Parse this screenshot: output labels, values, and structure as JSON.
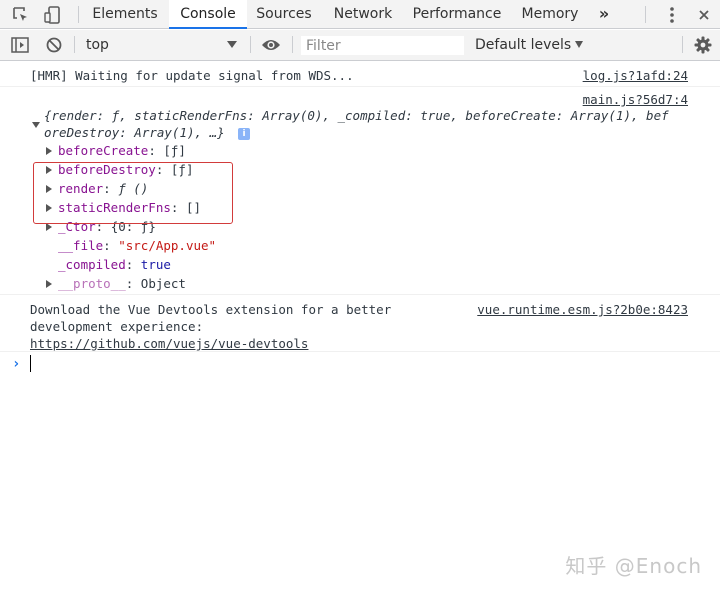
{
  "tabs": [
    {
      "label": "Elements"
    },
    {
      "label": "Console"
    },
    {
      "label": "Sources"
    },
    {
      "label": "Network"
    },
    {
      "label": "Performance"
    },
    {
      "label": "Memory"
    }
  ],
  "more_tabs": "»",
  "toolbar": {
    "context": "top",
    "filter_placeholder": "Filter",
    "levels": "Default levels"
  },
  "console": {
    "hmr": {
      "text": "[HMR] Waiting for update signal from WDS...",
      "source": "log.js?1afd:24"
    },
    "object": {
      "source": "main.js?56d7:4",
      "summary_line1": "{render: ƒ, staticRenderFns: Array(0), _compiled: true, beforeCreate: Array(1), bef",
      "summary_line2": "oreDestroy: Array(1), …}",
      "props": [
        {
          "name": "beforeCreate",
          "value": "[ƒ]"
        },
        {
          "name": "beforeDestroy",
          "value": "[ƒ]"
        },
        {
          "name": "render",
          "value": "ƒ ()"
        },
        {
          "name": "staticRenderFns",
          "value": "[]"
        },
        {
          "name": "_Ctor",
          "value": "{0: ƒ}"
        },
        {
          "name": "__file",
          "value": "\"src/App.vue\""
        },
        {
          "name": "_compiled",
          "value": "true"
        },
        {
          "name": "__proto__",
          "value": "Object"
        }
      ]
    },
    "devtools": {
      "line1": "Download the Vue Devtools extension for a better",
      "line2": "development experience:",
      "link": "https://github.com/vuejs/vue-devtools",
      "source": "vue.runtime.esm.js?2b0e:8423"
    },
    "prompt": "›"
  },
  "watermark": "知乎 @Enoch",
  "icons": [
    "inspect-icon",
    "device-toggle-icon",
    "more-vert-icon",
    "sidebar-toggle-icon",
    "clear-console-icon",
    "eye-icon",
    "settings-gear-icon",
    "info-icon"
  ]
}
